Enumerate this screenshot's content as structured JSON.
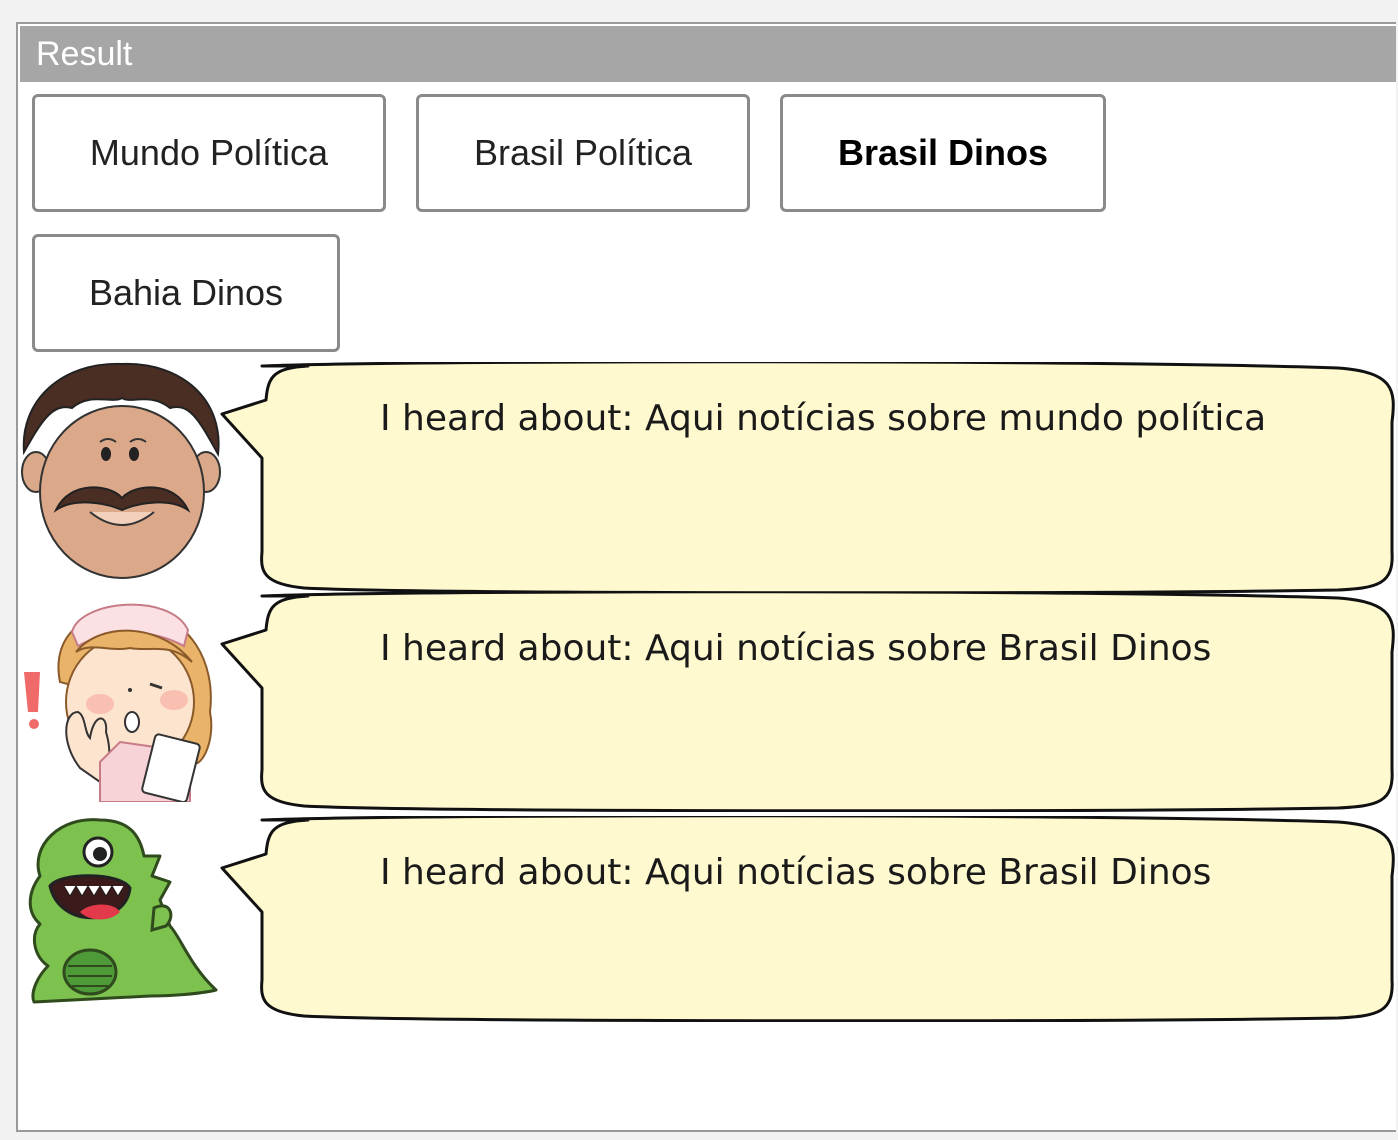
{
  "panel": {
    "title": "Result"
  },
  "topics": [
    {
      "label": "Mundo Política",
      "selected": false
    },
    {
      "label": "Brasil Política",
      "selected": false
    },
    {
      "label": "Brasil Dinos",
      "selected": true
    },
    {
      "label": "Bahia Dinos",
      "selected": false
    }
  ],
  "speakers": [
    {
      "avatar": "mustache-man-icon",
      "message": "I heard about: Aqui notícias sobre mundo política"
    },
    {
      "avatar": "nurse-icon",
      "message": "I heard about: Aqui notícias sobre Brasil Dinos"
    },
    {
      "avatar": "green-dinosaur-icon",
      "message": "I heard about: Aqui notícias sobre Brasil Dinos"
    }
  ],
  "colors": {
    "header_bg": "#a6a6a6",
    "bubble_fill": "#fff9cf",
    "button_border": "#8a8a8a"
  }
}
